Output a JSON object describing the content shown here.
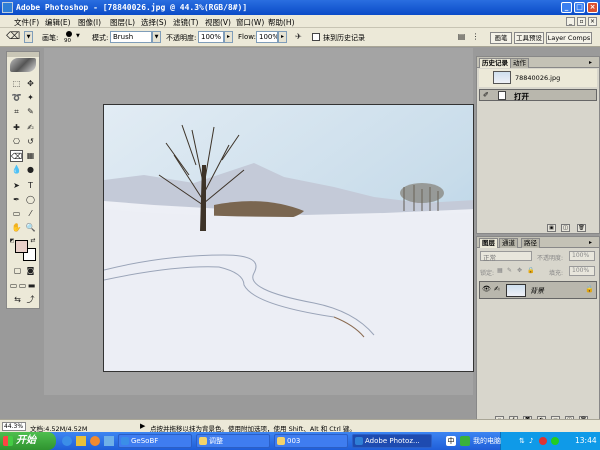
{
  "window": {
    "title": "Adobe Photoshop - [78840026.jpg @ 44.3%(RGB/8#)]",
    "min": "_",
    "max": "□",
    "close": "×"
  },
  "menu": [
    "文件(F)",
    "编辑(E)",
    "图像(I)",
    "图层(L)",
    "选择(S)",
    "滤镜(T)",
    "视图(V)",
    "窗口(W)",
    "帮助(H)"
  ],
  "options": {
    "brush_label": "画笔:",
    "brush_size": "90",
    "mode_label": "模式:",
    "mode_value": "Brush",
    "opacity_label": "不透明度:",
    "opacity_value": "100%",
    "flow_label": "Flow:",
    "flow_value": "100%",
    "history_label": "抹到历史记录",
    "palette_tabs": [
      "画笔",
      "工具预设",
      "Layer Comps"
    ]
  },
  "history": {
    "tabs": [
      "历史记录",
      "动作"
    ],
    "snapshot_name": "78840026.jpg",
    "step": "打开"
  },
  "layers": {
    "tabs": [
      "图层",
      "通道",
      "路径"
    ],
    "blend_mode": "正常",
    "opacity_label": "不透明度:",
    "opacity_value": "100%",
    "lock_label": "锁定:",
    "fill_label": "填充:",
    "fill_value": "100%",
    "layer_name": "背景"
  },
  "status": {
    "zoom": "44.3%",
    "doc": "文档:4.52M/4.52M",
    "hint": "点按并拖移以抹为背景色。使用附加选项，使用 Shift、Alt 和 Ctrl 键。"
  },
  "taskbar": {
    "start": "开始",
    "buttons": [
      "GeSoBF",
      "调整",
      "003",
      "Adobe Photoz..."
    ],
    "tray_label": "我的电脑",
    "clock": "13:44"
  },
  "colors": {
    "foreground": "#e8cfc8",
    "background": "#ffffff",
    "accent": "#0a4bc7"
  }
}
